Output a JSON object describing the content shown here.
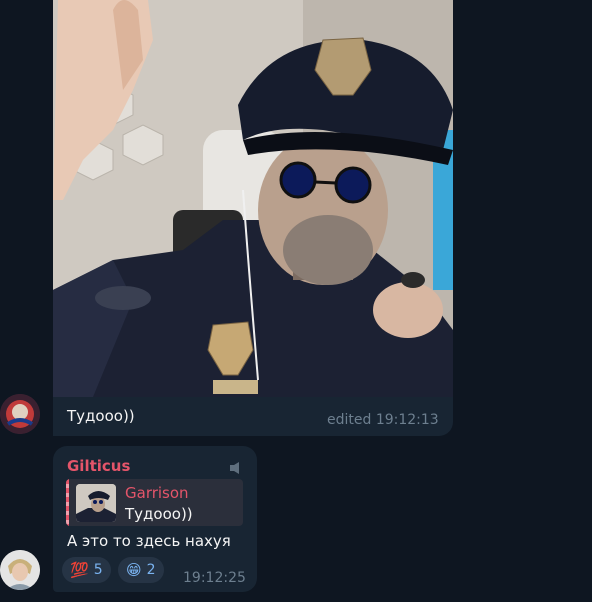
{
  "message1": {
    "text": "Тудооо))",
    "edited_time": "edited 19:12:13"
  },
  "message2": {
    "sender": "Gilticus",
    "reply": {
      "author": "Garrison",
      "text": "Тудооо))"
    },
    "text": "А это то здесь нахуя",
    "reactions": [
      {
        "emoji": "💯",
        "count": "5"
      },
      {
        "emoji": "😁",
        "count": "2"
      }
    ],
    "time": "19:12:25"
  },
  "colors": {
    "background": "#0e1621",
    "bubble": "#182533",
    "sender_name": "#e4556a",
    "meta": "#6d7f8f",
    "reaction_count": "#7ab3f0"
  },
  "icons": [
    "pinned-speaker-icon",
    "avatar-garrison",
    "avatar-gilticus"
  ]
}
